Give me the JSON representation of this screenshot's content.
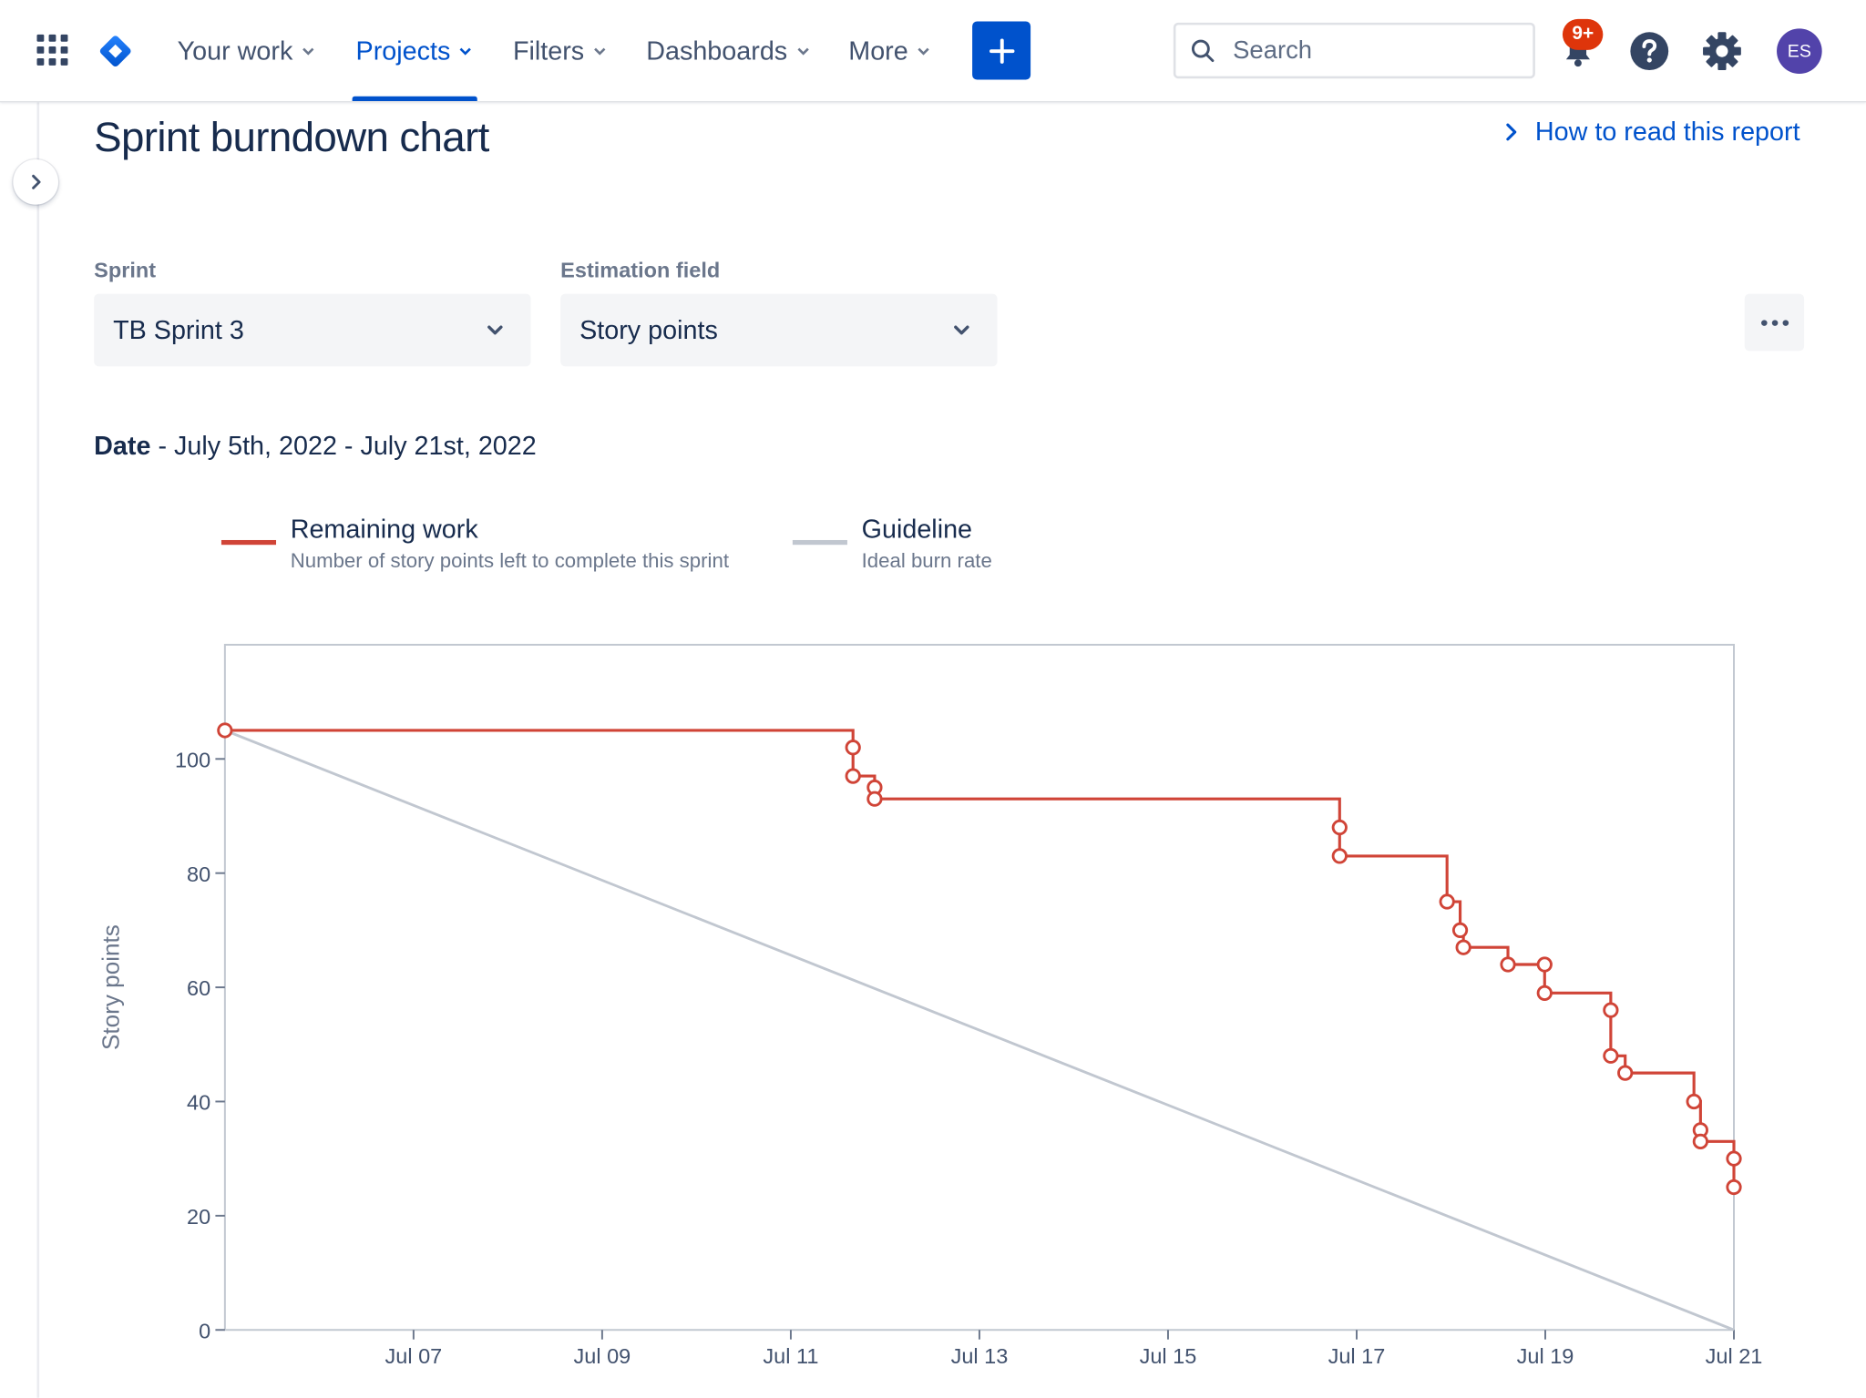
{
  "nav": {
    "items": [
      {
        "label": "Your work"
      },
      {
        "label": "Projects"
      },
      {
        "label": "Filters"
      },
      {
        "label": "Dashboards"
      },
      {
        "label": "More"
      }
    ],
    "search_placeholder": "Search",
    "notification_badge": "9+",
    "avatar_initials": "ES"
  },
  "page": {
    "title": "Sprint burndown chart",
    "help_link": "How to read this report",
    "sprint_label": "Sprint",
    "sprint_value": "TB Sprint 3",
    "estimation_label": "Estimation field",
    "estimation_value": "Story points",
    "date_label": "Date",
    "date_range": " - July 5th, 2022 - July 21st, 2022"
  },
  "legend": {
    "remaining_title": "Remaining work",
    "remaining_desc": "Number of story points left to complete this sprint",
    "guideline_title": "Guideline",
    "guideline_desc": "Ideal burn rate"
  },
  "colors": {
    "brand": "#0052cc",
    "remaining": "#d04437",
    "guideline": "#c1c7d0",
    "badge": "#de350b"
  },
  "chart_data": {
    "type": "line",
    "ylabel": "Story points",
    "xlabel": "",
    "ylim": [
      0,
      120
    ],
    "xlim": [
      "Jul 05",
      "Jul 22"
    ],
    "y_ticks": [
      0,
      20,
      40,
      60,
      80,
      100
    ],
    "x_ticks": [
      "Jul 07",
      "Jul 09",
      "Jul 11",
      "Jul 13",
      "Jul 15",
      "Jul 17",
      "Jul 19",
      "Jul 21"
    ],
    "series": [
      {
        "name": "Remaining work",
        "line": "step",
        "points": [
          {
            "x": "2022-07-05T00:00",
            "y": 105
          },
          {
            "x": "2022-07-11T15:50",
            "y": 102
          },
          {
            "x": "2022-07-11T15:50",
            "y": 97
          },
          {
            "x": "2022-07-11T21:20",
            "y": 95
          },
          {
            "x": "2022-07-11T21:20",
            "y": 93
          },
          {
            "x": "2022-07-16T19:40",
            "y": 88
          },
          {
            "x": "2022-07-16T19:40",
            "y": 83
          },
          {
            "x": "2022-07-17T23:00",
            "y": 75
          },
          {
            "x": "2022-07-18T02:20",
            "y": 70
          },
          {
            "x": "2022-07-18T03:10",
            "y": 67
          },
          {
            "x": "2022-07-18T14:30",
            "y": 64
          },
          {
            "x": "2022-07-18T23:50",
            "y": 64
          },
          {
            "x": "2022-07-18T23:50",
            "y": 59
          },
          {
            "x": "2022-07-19T16:40",
            "y": 56
          },
          {
            "x": "2022-07-19T16:40",
            "y": 48
          },
          {
            "x": "2022-07-19T20:20",
            "y": 45
          },
          {
            "x": "2022-07-20T13:50",
            "y": 40
          },
          {
            "x": "2022-07-20T15:30",
            "y": 35
          },
          {
            "x": "2022-07-20T15:30",
            "y": 33
          },
          {
            "x": "2022-07-21T00:00",
            "y": 30
          },
          {
            "x": "2022-07-21T00:00",
            "y": 25
          }
        ]
      },
      {
        "name": "Guideline",
        "line": "straight",
        "points": [
          {
            "x": "2022-07-05T00:00",
            "y": 105
          },
          {
            "x": "2022-07-21T00:00",
            "y": 0
          }
        ]
      }
    ]
  }
}
